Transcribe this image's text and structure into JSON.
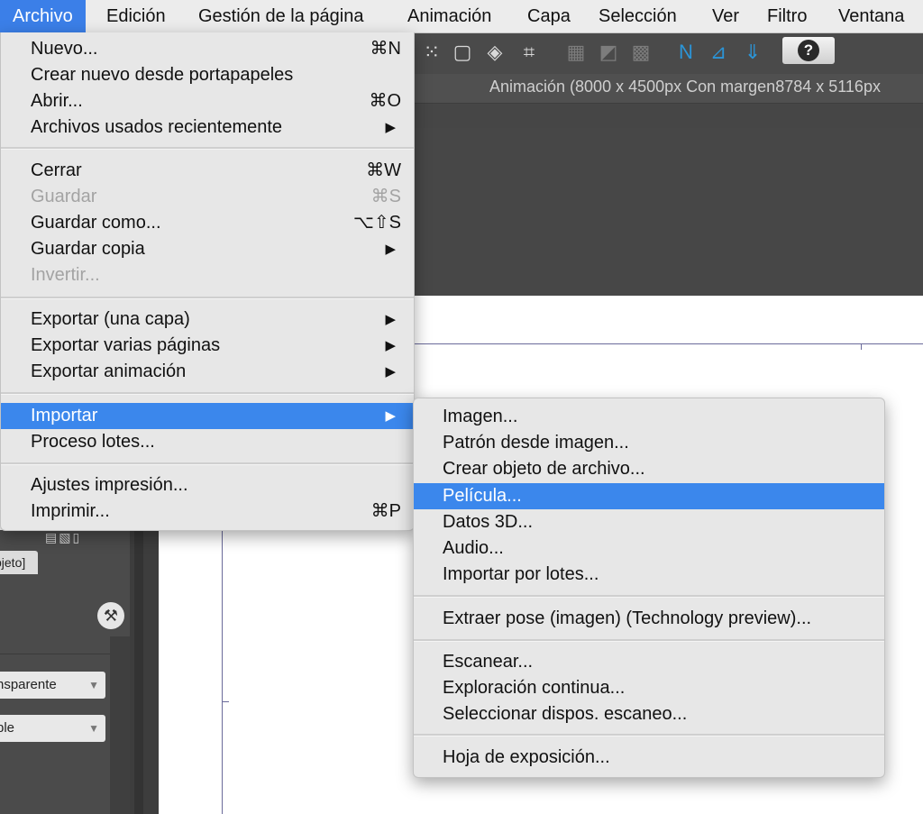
{
  "menubar": {
    "items": [
      "Archivo",
      "Edición",
      "Gestión de la página",
      "Animación",
      "Capa",
      "Selección",
      "Ver",
      "Filtro",
      "Ventana"
    ]
  },
  "document": {
    "title": "Animación (8000 x 4500px Con margen8784 x 5116px"
  },
  "toolbar": {
    "icons": [
      "grid-dots-icon",
      "transform-icon",
      "fill-bucket-icon",
      "crop-icon",
      "grid-icon",
      "ruler-icon",
      "guide-icon",
      "pen-ruler-icon",
      "perspective-icon",
      "symmetry-icon",
      "help-icon"
    ],
    "help_glyph": "?"
  },
  "left_panel": {
    "tab_label": "bjeto]",
    "select1": "nsparente",
    "select2": "ble"
  },
  "file_menu": {
    "items": [
      {
        "label": "Nuevo...",
        "shortcut": "⌘N"
      },
      {
        "label": "Crear nuevo desde portapapeles",
        "shortcut": ""
      },
      {
        "label": "Abrir...",
        "shortcut": "⌘O"
      },
      {
        "label": "Archivos usados recientemente",
        "shortcut": "▶"
      },
      {
        "label": "Cerrar",
        "shortcut": "⌘W"
      },
      {
        "label": "Guardar",
        "shortcut": "⌘S",
        "disabled": true
      },
      {
        "label": "Guardar como...",
        "shortcut": "⌥⇧S"
      },
      {
        "label": "Guardar copia",
        "shortcut": "▶"
      },
      {
        "label": "Invertir...",
        "shortcut": "",
        "disabled": true
      },
      {
        "label": "Exportar (una capa)",
        "shortcut": "▶"
      },
      {
        "label": "Exportar varias páginas",
        "shortcut": "▶"
      },
      {
        "label": "Exportar animación",
        "shortcut": "▶"
      },
      {
        "label": "Importar",
        "shortcut": "▶",
        "highlighted": true
      },
      {
        "label": "Proceso lotes...",
        "shortcut": ""
      },
      {
        "label": "Ajustes impresión...",
        "shortcut": ""
      },
      {
        "label": "Imprimir...",
        "shortcut": "⌘P"
      }
    ]
  },
  "import_submenu": {
    "items": [
      {
        "label": "Imagen..."
      },
      {
        "label": "Patrón desde imagen..."
      },
      {
        "label": "Crear objeto de archivo..."
      },
      {
        "label": "Película...",
        "highlighted": true
      },
      {
        "label": "Datos 3D..."
      },
      {
        "label": "Audio..."
      },
      {
        "label": "Importar por lotes..."
      },
      {
        "label": "Extraer pose (imagen) (Technology preview)..."
      },
      {
        "label": "Escanear..."
      },
      {
        "label": "Exploración continua..."
      },
      {
        "label": "Seleccionar dispos. escaneo..."
      },
      {
        "label": "Hoja de exposición..."
      }
    ]
  }
}
